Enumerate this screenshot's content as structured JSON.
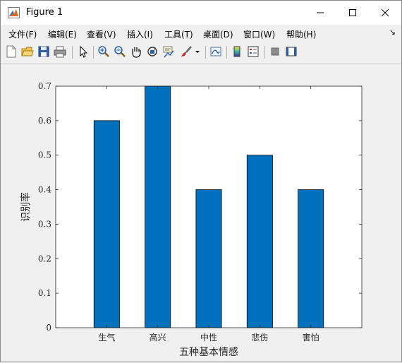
{
  "window": {
    "title": "Figure 1"
  },
  "menu": [
    "文件(F)",
    "编辑(E)",
    "查看(V)",
    "插入(I)",
    "工具(T)",
    "桌面(D)",
    "窗口(W)",
    "帮助(H)"
  ],
  "toolbar_icons": [
    "new-figure-icon",
    "open-file-icon",
    "save-icon",
    "print-icon",
    "pointer-icon",
    "zoom-in-icon",
    "zoom-out-icon",
    "pan-icon",
    "rotate-3d-icon",
    "data-cursor-icon",
    "brush-icon",
    "brush-dropdown-icon",
    "link-plot-icon",
    "colorbar-icon",
    "legend-icon",
    "hide-plot-tools-icon",
    "show-plot-tools-icon"
  ],
  "colors": {
    "bar": "#0072bd",
    "axes_bg": "#ffffff"
  },
  "chart_data": {
    "type": "bar",
    "categories": [
      "生气",
      "高兴",
      "中性",
      "悲伤",
      "害怕"
    ],
    "values": [
      0.6,
      0.7,
      0.4,
      0.5,
      0.4
    ],
    "title": "",
    "xlabel": "五种基本情感",
    "ylabel": "识别率",
    "ylim": [
      0,
      0.7
    ],
    "yticks": [
      "0",
      "0.1",
      "0.2",
      "0.3",
      "0.4",
      "0.5",
      "0.6",
      "0.7"
    ],
    "grid": false
  }
}
